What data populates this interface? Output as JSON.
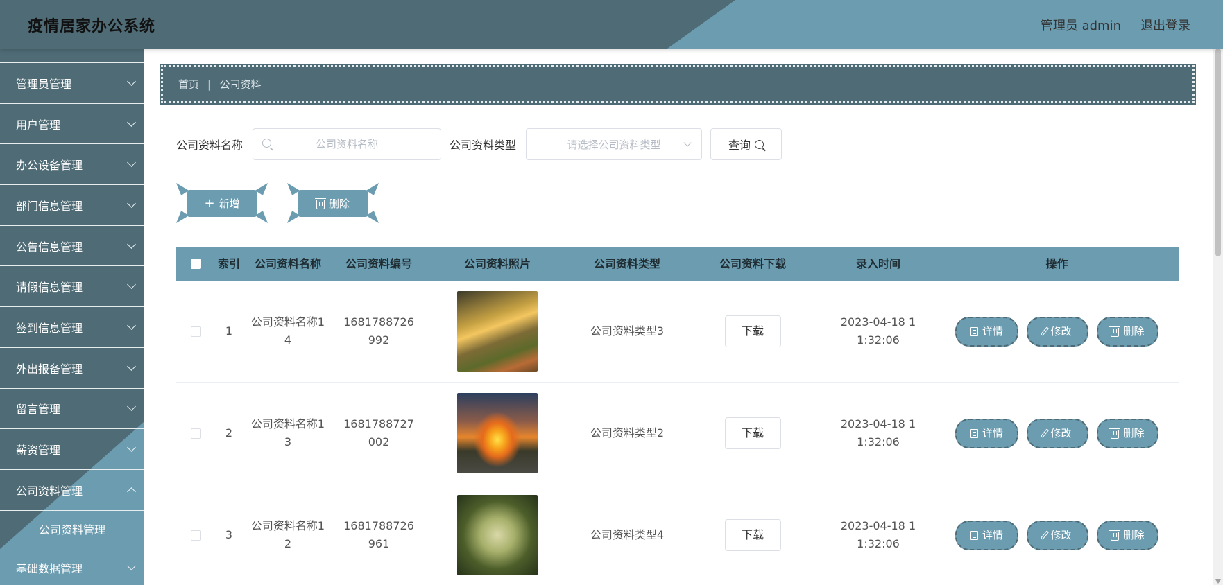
{
  "header": {
    "title": "疫情居家办公系统",
    "user": "管理员 admin",
    "logout": "退出登录"
  },
  "sidebar": {
    "items": [
      {
        "label": "管理员管理"
      },
      {
        "label": "用户管理"
      },
      {
        "label": "办公设备管理"
      },
      {
        "label": "部门信息管理"
      },
      {
        "label": "公告信息管理"
      },
      {
        "label": "请假信息管理"
      },
      {
        "label": "签到信息管理"
      },
      {
        "label": "外出报备管理"
      },
      {
        "label": "留言管理"
      },
      {
        "label": "薪资管理"
      },
      {
        "label": "公司资料管理",
        "open": true
      },
      {
        "label": "基础数据管理"
      }
    ],
    "sub_item": "公司资料管理"
  },
  "breadcrumb": {
    "home": "首页",
    "current": "公司资料"
  },
  "search": {
    "name_label": "公司资料名称",
    "name_placeholder": "公司资料名称",
    "type_label": "公司资料类型",
    "type_placeholder": "请选择公司资料类型",
    "query_label": "查询"
  },
  "actions": {
    "add": "新增",
    "delete": "删除"
  },
  "table": {
    "headers": [
      "索引",
      "公司资料名称",
      "公司资料编号",
      "公司资料照片",
      "公司资料类型",
      "公司资料下载",
      "录入时间",
      "操作"
    ],
    "rows": [
      {
        "index": "1",
        "name": "公司资料名称14",
        "code": "1681788726992",
        "type": "公司资料类型3",
        "download": "下载",
        "time": "2023-04-18 11:32:06"
      },
      {
        "index": "2",
        "name": "公司资料名称13",
        "code": "1681788727002",
        "type": "公司资料类型2",
        "download": "下载",
        "time": "2023-04-18 11:32:06"
      },
      {
        "index": "3",
        "name": "公司资料名称12",
        "code": "1681788726961",
        "type": "公司资料类型4",
        "download": "下载",
        "time": "2023-04-18 11:32:06"
      }
    ],
    "ops": {
      "detail": "详情",
      "edit": "修改",
      "delete": "删除"
    }
  },
  "colors": {
    "primary": "#6b9cb0",
    "dark": "#4f6b75"
  }
}
